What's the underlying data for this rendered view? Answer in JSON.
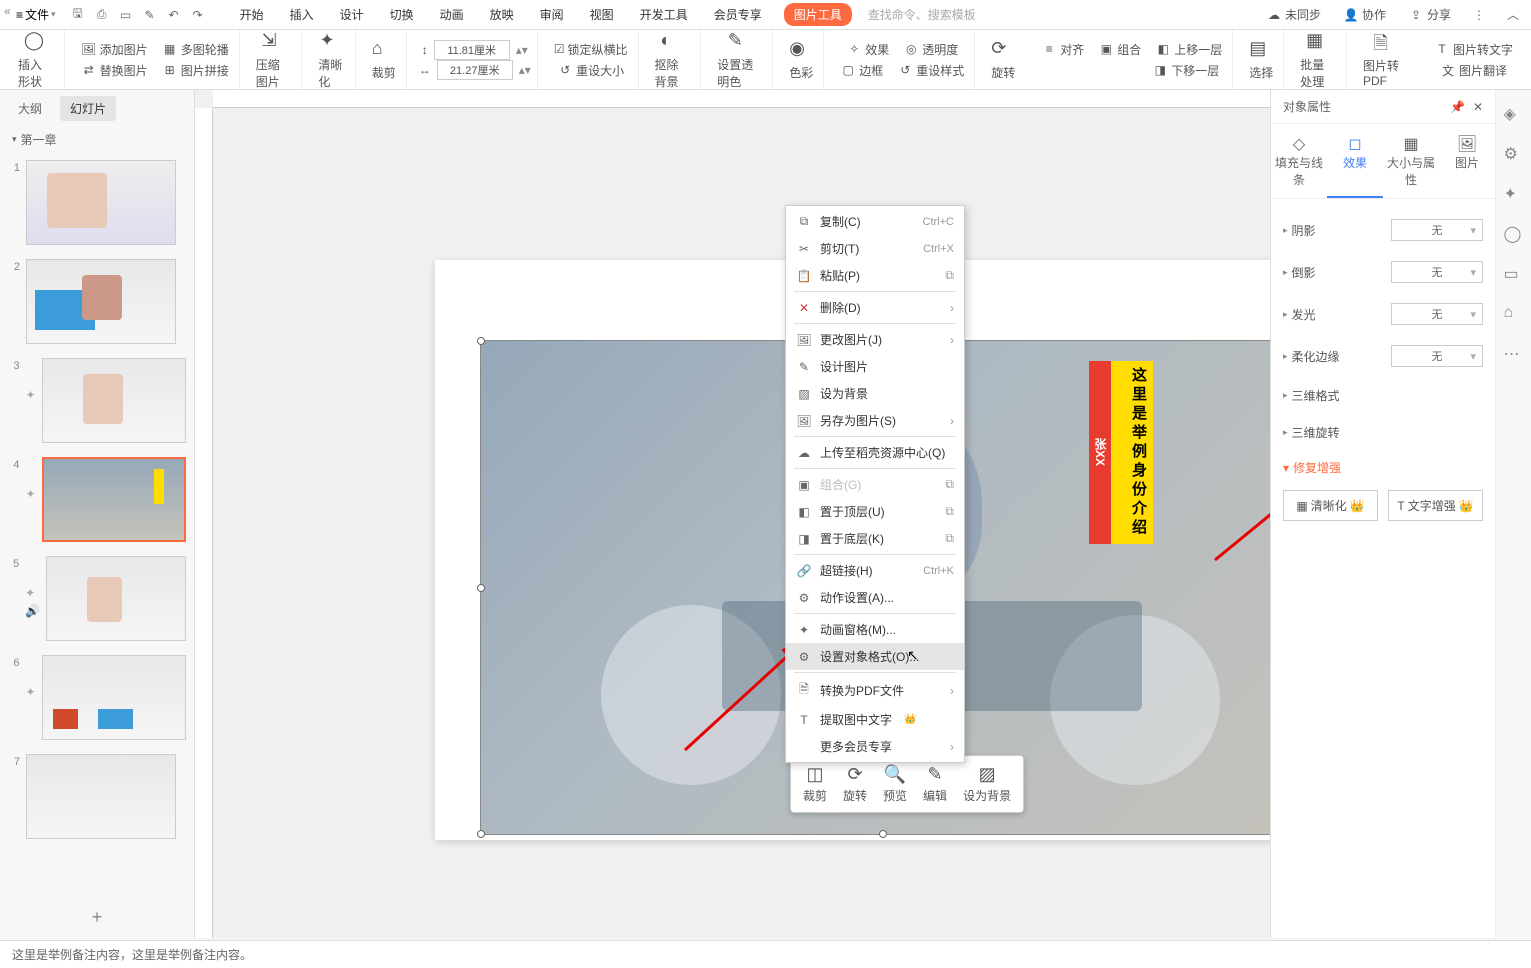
{
  "titlebar": {
    "file": "文件",
    "right": {
      "unsync": "未同步",
      "collab": "协作",
      "share": "分享"
    }
  },
  "tabs": {
    "start": "开始",
    "insert": "插入",
    "design": "设计",
    "transition": "切换",
    "anim": "动画",
    "show": "放映",
    "review": "审阅",
    "view": "视图",
    "dev": "开发工具",
    "vip": "会员专享",
    "pictools": "图片工具"
  },
  "search_placeholder": "查找命令、搜索模板",
  "ribbon": {
    "insert_shape": "插入形状",
    "add_pic": "添加图片",
    "multi_pic": "多图轮播",
    "replace_pic": "替换图片",
    "pic_join": "图片拼接",
    "compress": "压缩图片",
    "sharpen": "清晰化",
    "crop": "裁剪",
    "height": "11.81厘米",
    "width": "21.27厘米",
    "lock_ratio": "锁定纵横比",
    "reset_size": "重设大小",
    "remove_bg": "抠除背景",
    "set_trans": "设置透明色",
    "color": "色彩",
    "effect": "效果",
    "transparency": "透明度",
    "border": "边框",
    "reset_style": "重设样式",
    "rotate": "旋转",
    "align": "对齐",
    "group": "组合",
    "bring_fwd": "上移一层",
    "send_bwd": "下移一层",
    "select": "选择",
    "batch": "批量处理",
    "to_pdf": "图片转PDF",
    "to_text": "图片转文字",
    "translate": "图片翻译"
  },
  "left": {
    "outline": "大纲",
    "slides": "幻灯片",
    "chapter": "第一章",
    "add": "+",
    "nums": [
      "1",
      "2",
      "3",
      "4",
      "5",
      "6",
      "7"
    ]
  },
  "context": {
    "copy": "复制(C)",
    "copy_sc": "Ctrl+C",
    "cut": "剪切(T)",
    "cut_sc": "Ctrl+X",
    "paste": "粘贴(P)",
    "delete": "删除(D)",
    "change_pic": "更改图片(J)",
    "design_pic": "设计图片",
    "set_bg": "设为背景",
    "save_as": "另存为图片(S)",
    "upload": "上传至稻壳资源中心(Q)",
    "group": "组合(G)",
    "top": "置于顶层(U)",
    "bottom": "置于底层(K)",
    "hyperlink": "超链接(H)",
    "hyperlink_sc": "Ctrl+K",
    "action": "动作设置(A)...",
    "anim_pane": "动画窗格(M)...",
    "format_obj": "设置对象格式(O)...",
    "to_pdf": "转换为PDF文件",
    "extract_text": "提取图中文字",
    "more_vip": "更多会员专享"
  },
  "float": {
    "crop": "裁剪",
    "rotate": "旋转",
    "preview": "预览",
    "edit": "编辑",
    "setbg": "设为背景"
  },
  "overlay": {
    "red": "张XX",
    "yellow": "这里是举例身份介绍"
  },
  "right_panel": {
    "title": "对象属性",
    "tab_fill": "填充与线条",
    "tab_fx": "效果",
    "tab_size": "大小与属性",
    "tab_pic": "图片",
    "shadow": "阴影",
    "reflect": "倒影",
    "glow": "发光",
    "soft": "柔化边缘",
    "d3fmt": "三维格式",
    "d3rot": "三维旋转",
    "none": "无",
    "fix": "修复增强",
    "sharpen": "清晰化",
    "text_enhance": "文字增强"
  },
  "status": "这里是举例备注内容，这里是举例备注内容。"
}
